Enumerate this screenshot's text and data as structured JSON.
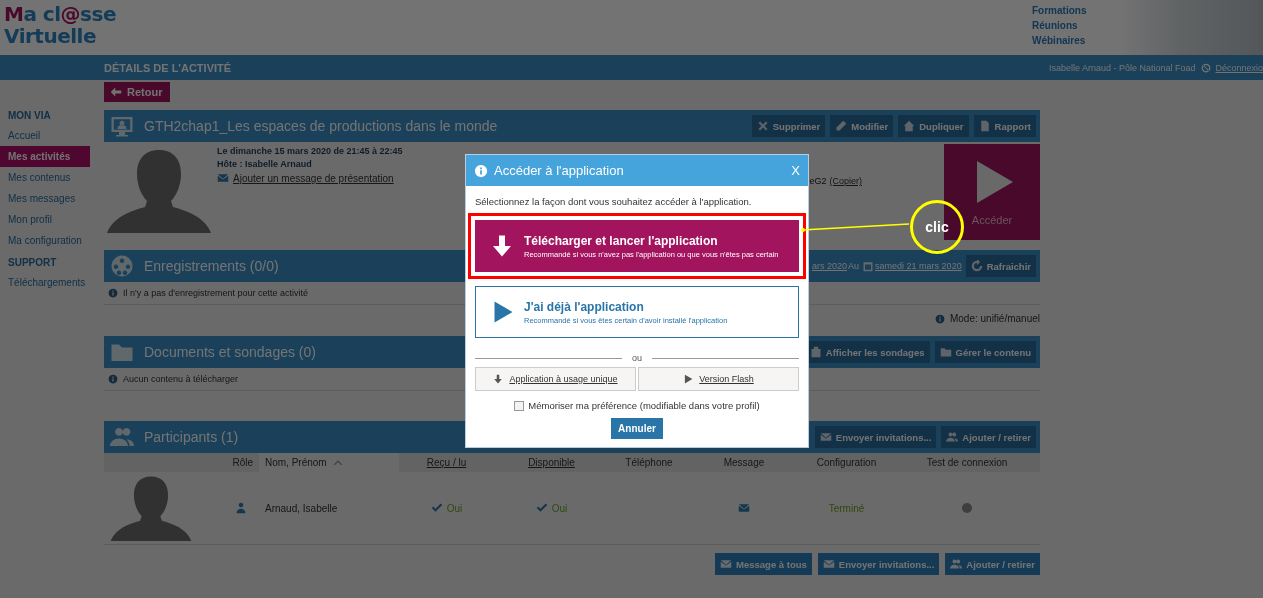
{
  "header": {
    "logo": [
      {
        "text": "M",
        "accent": true
      },
      {
        "text": "a cl",
        "accent": false
      },
      {
        "text": "@",
        "accent": true
      },
      {
        "text": "sse",
        "accent": false
      }
    ],
    "logo_line2": "Virtuelle",
    "links": [
      "Formations",
      "Réunions",
      "Wébinaires"
    ]
  },
  "topbar": {
    "title": "DÉTAILS DE L'ACTIVITÉ",
    "user": "Isabelle Arnaud - Pôle National Foad",
    "logout": "Déconnexio"
  },
  "sidebar": [
    {
      "kind": "heading",
      "label": "MON VIA"
    },
    {
      "kind": "item",
      "label": "Accueil",
      "selected": false
    },
    {
      "kind": "item",
      "label": "Mes activités",
      "selected": true
    },
    {
      "kind": "item",
      "label": "Mes contenus",
      "selected": false
    },
    {
      "kind": "item",
      "label": "Mes messages",
      "selected": false
    },
    {
      "kind": "item",
      "label": "Mon profil",
      "selected": false
    },
    {
      "kind": "item",
      "label": "Ma configuration",
      "selected": false
    },
    {
      "kind": "heading",
      "label": "SUPPORT"
    },
    {
      "kind": "item",
      "label": "Téléchargements",
      "selected": false
    }
  ],
  "back_button": "Retour",
  "activity": {
    "title": "GTH2chap1_Les espaces de productions dans le monde",
    "actions": [
      {
        "kind": "delete",
        "label": "Supprimer"
      },
      {
        "kind": "edit",
        "label": "Modifier"
      },
      {
        "kind": "duplicate",
        "label": "Dupliquer"
      },
      {
        "kind": "report",
        "label": "Rapport"
      }
    ],
    "date": "Le dimanche 15 mars 2020 de 21:45 à 22:45",
    "host": "Hôte : Isabelle Arnaud",
    "message_link": "Ajouter un message de présentation",
    "code_fragment": "eG2",
    "copy_link": "(Copier)",
    "launch": "Accéder"
  },
  "recordings": {
    "title": "Enregistrements (0/0)",
    "date_from": "ars 2020",
    "date_to_label": "Au",
    "date_to": "samedi 21 mars 2020",
    "refresh": "Rafraichir",
    "empty": "Il n'y a pas d'enregistrement pour cette activité",
    "mode": "Mode: unifié/manuel"
  },
  "documents": {
    "title": "Documents et sondages (0)",
    "actions": [
      {
        "kind": "survey",
        "label": "Afficher les sondages"
      },
      {
        "kind": "folder",
        "label": "Gérer le contenu"
      }
    ],
    "empty": "Aucun contenu à télécharger"
  },
  "participants": {
    "title": "Participants (1)",
    "actions": [
      {
        "kind": "mail",
        "label": "Envoyer invitations..."
      },
      {
        "kind": "people",
        "label": "Ajouter / retirer"
      }
    ],
    "columns": [
      {
        "kind": "plain",
        "label": "Rôle"
      },
      {
        "kind": "sorted",
        "label": "Nom, Prénom"
      },
      {
        "kind": "link",
        "label": "Reçu / lu"
      },
      {
        "kind": "link",
        "label": "Disponible"
      },
      {
        "kind": "plain",
        "label": "Téléphone"
      },
      {
        "kind": "plain",
        "label": "Message"
      },
      {
        "kind": "plain",
        "label": "Configuration"
      },
      {
        "kind": "plain",
        "label": "Test de connexion"
      }
    ],
    "rows": [
      {
        "name": "Arnaud, Isabelle",
        "received": "Oui",
        "available": "Oui",
        "configuration": "Terminé"
      }
    ],
    "footer_actions": [
      {
        "kind": "mail",
        "label": "Message à tous"
      },
      {
        "kind": "mail",
        "label": "Envoyer invitations..."
      },
      {
        "kind": "people",
        "label": "Ajouter / retirer"
      }
    ]
  },
  "modal": {
    "title": "Accéder à l'application",
    "close": "X",
    "intro": "Sélectionnez la façon dont vous souhaitez accéder à l'application.",
    "options": [
      {
        "kind": "download",
        "title": "Télécharger et lancer l'application",
        "subtitle": "Recommandé si vous n'avez pas l'application ou que vous n'êtes pas certain",
        "highlighted": true
      },
      {
        "kind": "play",
        "title": "J'ai déjà l'application",
        "subtitle": "Recommandé si vous êtes certain d'avoir installé l'application",
        "highlighted": false
      }
    ],
    "separator": "ou",
    "alt_options": [
      {
        "kind": "download",
        "label": "Application à usage unique"
      },
      {
        "kind": "play",
        "label": "Version Flash"
      }
    ],
    "remember": {
      "label": "Mémoriser ma préférence (modifiable dans votre profil)",
      "checked": false
    },
    "cancel": "Annuler"
  },
  "callout": {
    "label": "clic"
  }
}
